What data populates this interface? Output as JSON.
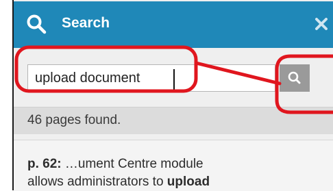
{
  "header": {
    "title": "Search",
    "search_icon": "search-icon",
    "close_icon": "close-icon",
    "background": "#1f88b8"
  },
  "search": {
    "value": "upload document",
    "button_icon": "search-icon"
  },
  "results": {
    "count_text": "46 pages found.",
    "items": [
      {
        "page": "p. 62:",
        "line1": " …ument Centre module",
        "line2_prefix": "allows administrators to ",
        "line2_highlight": "upload"
      }
    ]
  },
  "annotation": {
    "color": "#e0161e",
    "shape": "red-outline-callout"
  }
}
